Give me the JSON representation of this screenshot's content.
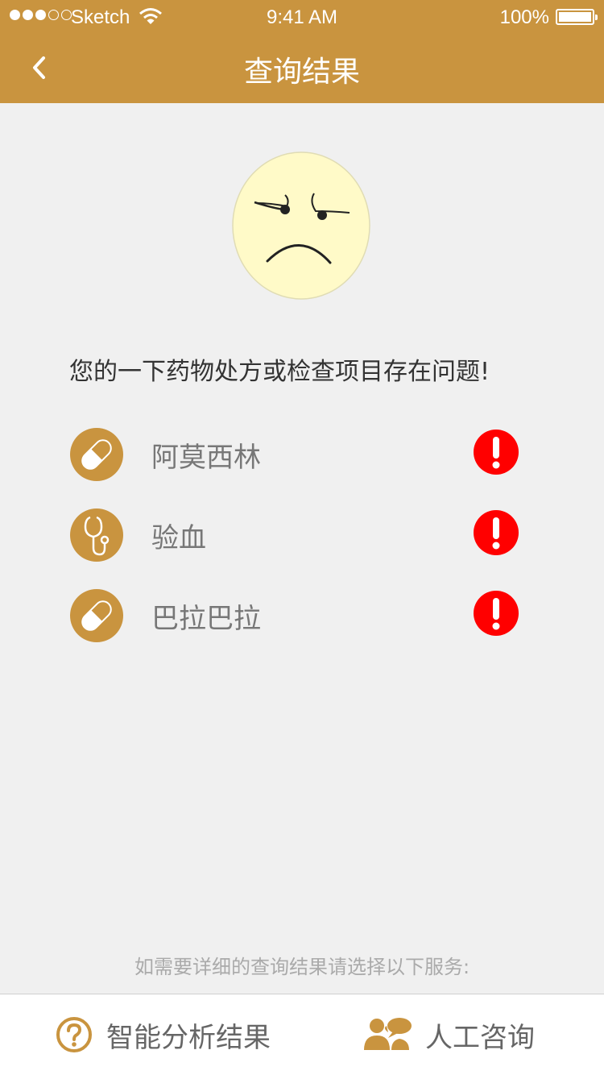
{
  "status_bar": {
    "carrier": "Sketch",
    "time": "9:41 AM",
    "battery": "100%"
  },
  "nav": {
    "title": "查询结果",
    "back_icon": "chevron-left-icon"
  },
  "colors": {
    "brand": "#c9943f",
    "alert": "#ff0000",
    "face": "#fffac8"
  },
  "result": {
    "face_icon": "sad-face-icon",
    "message": "您的一下药物处方或检查项目存在问题!"
  },
  "items": [
    {
      "label": "阿莫西林",
      "icon": "pill-icon",
      "status_icon": "alert-icon"
    },
    {
      "label": "验血",
      "icon": "stethoscope-icon",
      "status_icon": "alert-icon"
    },
    {
      "label": "巴拉巴拉",
      "icon": "pill-icon",
      "status_icon": "alert-icon"
    }
  ],
  "footer": {
    "hint": "如需要详细的查询结果请选择以下服务:",
    "smart_analysis_label": "智能分析结果",
    "smart_analysis_icon": "question-circle-icon",
    "human_consult_label": "人工咨询",
    "human_consult_icon": "people-chat-icon"
  }
}
